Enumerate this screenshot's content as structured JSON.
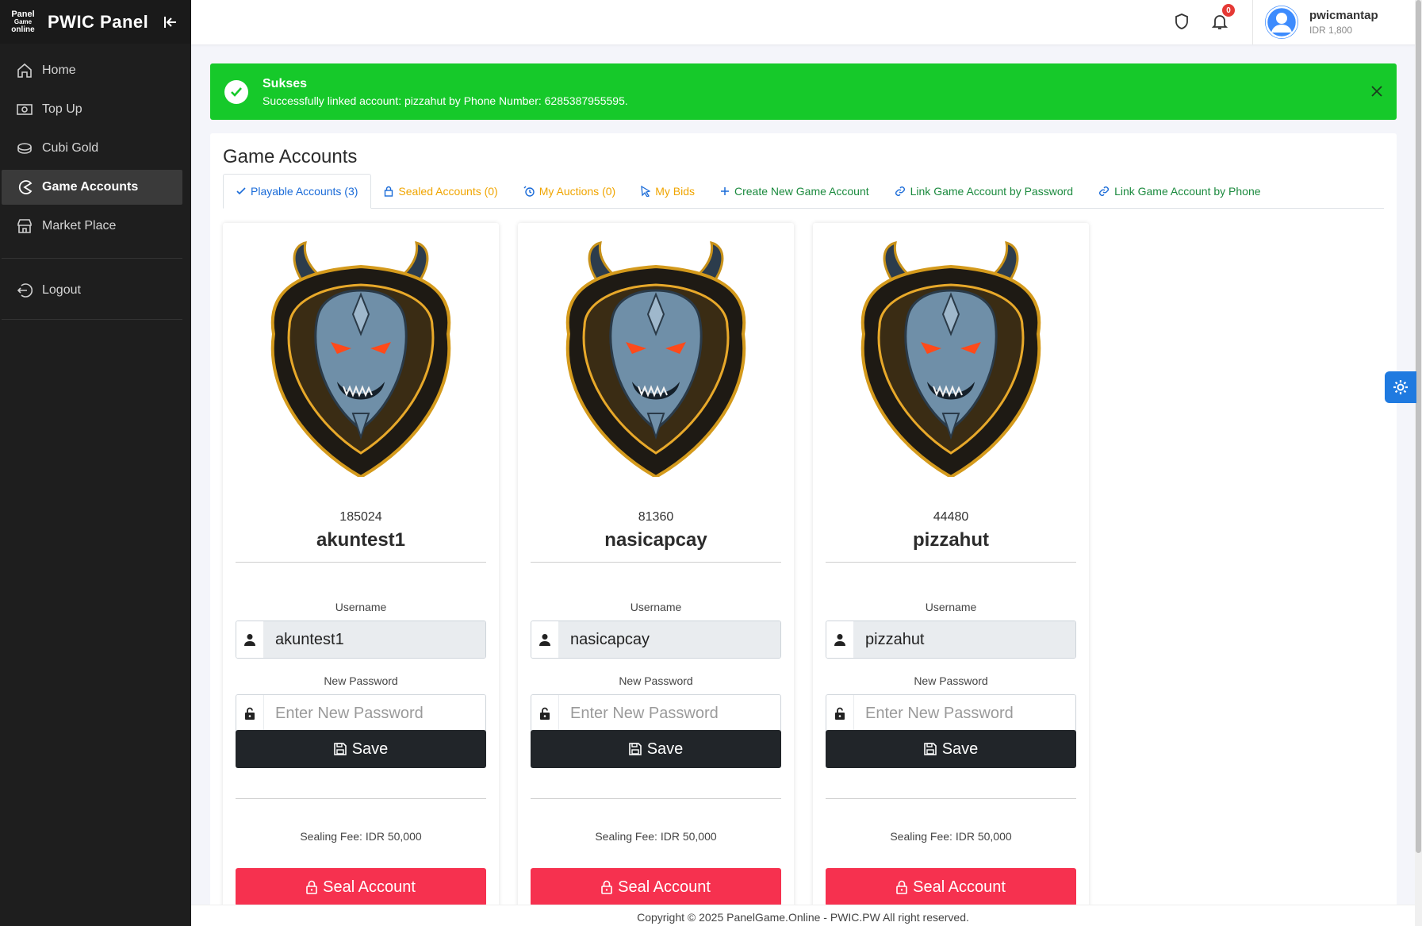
{
  "brand": {
    "logo_lines": [
      "Panel",
      "Game",
      "online"
    ],
    "name": "PWIC Panel"
  },
  "sidebar": {
    "items": [
      {
        "label": "Home",
        "icon": "home-icon",
        "active": false
      },
      {
        "label": "Top Up",
        "icon": "money-icon",
        "active": false
      },
      {
        "label": "Cubi Gold",
        "icon": "coin-icon",
        "active": false
      },
      {
        "label": "Game Accounts",
        "icon": "pacman-icon",
        "active": true
      },
      {
        "label": "Market Place",
        "icon": "store-icon",
        "active": false
      }
    ],
    "logout_label": "Logout"
  },
  "topbar": {
    "notification_count": "0",
    "user": {
      "name": "pwicmantap",
      "balance": "IDR 1,800"
    }
  },
  "alert": {
    "title": "Sukses",
    "message": "Successfully linked account: pizzahut by Phone Number: 6285387955595."
  },
  "page": {
    "title": "Game Accounts",
    "tabs": [
      {
        "label": "Playable Accounts (3)",
        "icon": "check-icon",
        "style": "active"
      },
      {
        "label": "Sealed Accounts (0)",
        "icon": "lock-icon",
        "style": "orange"
      },
      {
        "label": "My Auctions (0)",
        "icon": "auction-icon",
        "style": "orange"
      },
      {
        "label": "My Bids",
        "icon": "cursor-icon",
        "style": "orange"
      },
      {
        "label": "Create New Game Account",
        "icon": "plus-icon",
        "style": "green"
      },
      {
        "label": "Link Game Account by Password",
        "icon": "link-icon",
        "style": "green"
      },
      {
        "label": "Link Game Account by Phone",
        "icon": "link-icon",
        "style": "green"
      }
    ]
  },
  "accounts": [
    {
      "id": "185024",
      "name": "akuntest1",
      "username": "akuntest1"
    },
    {
      "id": "81360",
      "name": "nasicapcay",
      "username": "nasicapcay"
    },
    {
      "id": "44480",
      "name": "pizzahut",
      "username": "pizzahut"
    }
  ],
  "card_labels": {
    "username_label": "Username",
    "password_label": "New Password",
    "password_placeholder": "Enter New Password",
    "save_label": "Save",
    "fee_text": "Sealing Fee: IDR 50,000",
    "seal_label": "Seal Account"
  },
  "footer": {
    "text": "Copyright © 2025 PanelGame.Online - PWIC.PW All right reserved."
  },
  "colors": {
    "sidebar_bg": "#1e1e1e",
    "alert_green": "#16c92a",
    "save_dark": "#212529",
    "seal_red": "#f6314f",
    "tab_active_blue": "#1a6bd8",
    "tab_orange": "#f0a500",
    "tab_green": "#1b8a3e",
    "fab_blue": "#1f7ae0"
  }
}
